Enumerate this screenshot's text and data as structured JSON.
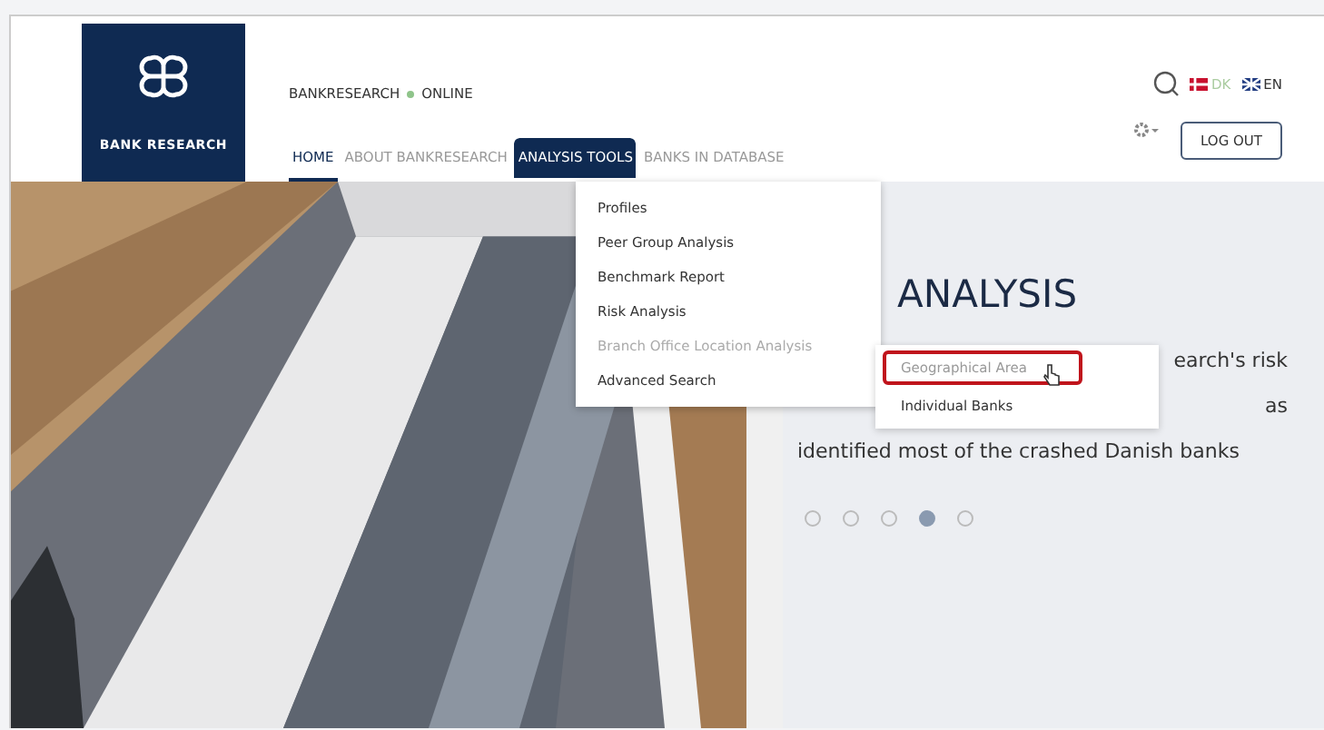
{
  "logo": {
    "text": "BANK RESEARCH"
  },
  "status": {
    "site": "BANKRESEARCH",
    "state": "ONLINE"
  },
  "languages": [
    {
      "code": "DK",
      "selected": false
    },
    {
      "code": "EN",
      "selected": true
    }
  ],
  "nav": [
    {
      "label": "HOME",
      "selected": true
    },
    {
      "label": "ABOUT BANKRESEARCH",
      "selected": false
    },
    {
      "label": "ANALYSIS TOOLS",
      "selected": false,
      "open": true
    },
    {
      "label": "BANKS IN DATABASE",
      "selected": false
    }
  ],
  "logout": "LOG OUT",
  "menu": [
    {
      "label": "Profiles",
      "disabled": false
    },
    {
      "label": "Peer Group Analysis",
      "disabled": false
    },
    {
      "label": "Benchmark Report",
      "disabled": false
    },
    {
      "label": "Risk Analysis",
      "disabled": false
    },
    {
      "label": "Branch Office Location Analysis",
      "disabled": true
    },
    {
      "label": "Advanced Search",
      "disabled": false
    }
  ],
  "submenu": [
    {
      "label": "Geographical Area",
      "selected": true
    },
    {
      "label": "Individual Banks",
      "selected": false
    }
  ],
  "hero": {
    "title": "ANALYSIS",
    "lines": [
      "earch's risk",
      "as",
      "identified most of the crashed Danish banks"
    ],
    "dots": [
      {
        "selected": false
      },
      {
        "selected": false
      },
      {
        "selected": false
      },
      {
        "selected": true
      },
      {
        "selected": false
      }
    ]
  }
}
